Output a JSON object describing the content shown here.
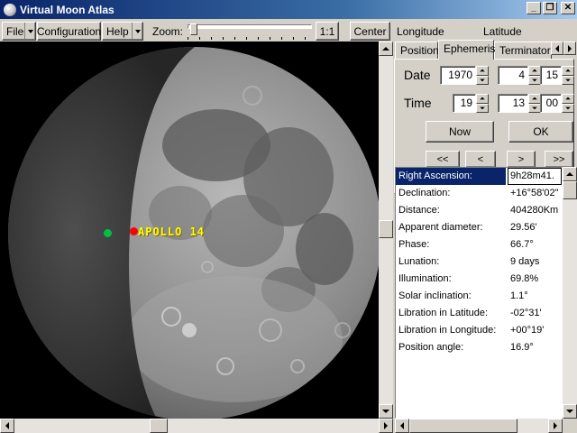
{
  "window": {
    "title": "Virtual Moon Atlas"
  },
  "toolbar": {
    "file_label": "File",
    "config_label": "Configuration",
    "help_label": "Help",
    "zoom_label": "Zoom:",
    "zoom_level": 0.02,
    "reset_zoom_label": "1:1",
    "center_label": "Center"
  },
  "map": {
    "labels": [
      {
        "text": "APOLLO 14"
      }
    ],
    "marker_colors": {
      "site": "#ff0000",
      "cursor": "#00c040"
    }
  },
  "coords": {
    "longitude_label": "Longitude",
    "latitude_label": "Latitude"
  },
  "tabs": [
    {
      "label": "Position"
    },
    {
      "label": "Ephemeris",
      "active": true
    },
    {
      "label": "Terminator"
    }
  ],
  "ephemeris_panel": {
    "date_label": "Date",
    "time_label": "Time",
    "date": {
      "year": "1970",
      "month": "4",
      "day": "15"
    },
    "time": {
      "hour": "19",
      "minute": "13",
      "second": "00"
    },
    "now_label": "Now",
    "ok_label": "OK",
    "nav": [
      "<<",
      "<",
      ">",
      ">>"
    ]
  },
  "ephemeris": [
    {
      "label": "Right Ascension:",
      "value": "9h28m41.",
      "selected": true
    },
    {
      "label": "Declination:",
      "value": "+16°58'02\""
    },
    {
      "label": "Distance:",
      "value": "404280Km"
    },
    {
      "label": "Apparent diameter:",
      "value": "29.56'"
    },
    {
      "label": "Phase:",
      "value": "66.7°"
    },
    {
      "label": "Lunation:",
      "value": "9 days"
    },
    {
      "label": "Illumination:",
      "value": "69.8%"
    },
    {
      "label": "Solar inclination:",
      "value": "1.1°"
    },
    {
      "label": "Libration in Latitude:",
      "value": "-02°31'"
    },
    {
      "label": "Libration in Longitude:",
      "value": "+00°19'"
    },
    {
      "label": "Position angle:",
      "value": "16.9°"
    }
  ],
  "icons": {
    "app": "moon-icon",
    "minimize": "minimize-icon",
    "restore": "restore-icon",
    "close": "close-icon"
  }
}
